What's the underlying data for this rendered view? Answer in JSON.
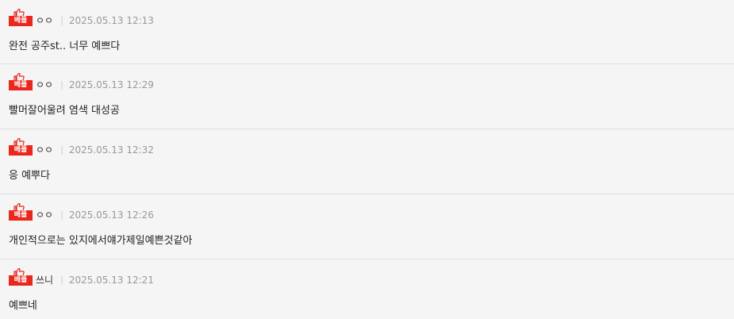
{
  "badge_label": "베플",
  "colors": {
    "badge": "#e8271d",
    "background": "#f5f5f5",
    "divider": "#dedede"
  },
  "comments": [
    {
      "nick": "ㅇㅇ",
      "date": "2025.05.13 12:13",
      "text": "완전 공주st.. 너무 예쁘다"
    },
    {
      "nick": "ㅇㅇ",
      "date": "2025.05.13 12:29",
      "text": "빨머잘어울려 염색 대성공"
    },
    {
      "nick": "ㅇㅇ",
      "date": "2025.05.13 12:32",
      "text": "응 예뿌다"
    },
    {
      "nick": "ㅇㅇ",
      "date": "2025.05.13 12:26",
      "text": "개인적으로는 있지에서얘가제일예쁜것같아"
    },
    {
      "nick": "쓰니",
      "date": "2025.05.13 12:21",
      "text": "예쁘네"
    }
  ]
}
